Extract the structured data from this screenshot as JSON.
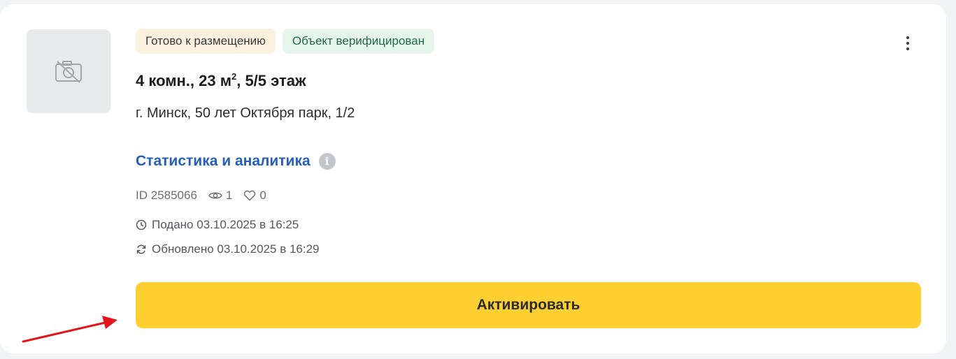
{
  "listing": {
    "badges": {
      "status": "Готово к размещению",
      "verified": "Объект верифицирован"
    },
    "title_main": "4 комн., 23 м",
    "title_sup": "2",
    "title_rest": ", 5/5 этаж",
    "address": "г. Минск, 50 лет Октября парк, 1/2",
    "stats_link": "Статистика и аналитика",
    "id_text": "ID 2585066",
    "views": "1",
    "favorites": "0",
    "posted": "Подано 03.10.2025 в 16:25",
    "updated": "Обновлено 03.10.2025 в 16:29",
    "activate_label": "Активировать"
  },
  "icons": {
    "photo": "no-photo-icon",
    "more": "more-vertical-icon",
    "info": "info-icon",
    "views": "eye-icon",
    "favorites": "heart-icon",
    "posted": "clock-icon",
    "updated": "refresh-icon"
  },
  "colors": {
    "accent_button": "#fdcf30",
    "link": "#2460b8",
    "status_badge_bg": "#fcf1dc",
    "verified_badge_bg": "#e6f6ec",
    "verified_badge_text": "#24684a",
    "annotation_arrow": "#e3161b"
  }
}
